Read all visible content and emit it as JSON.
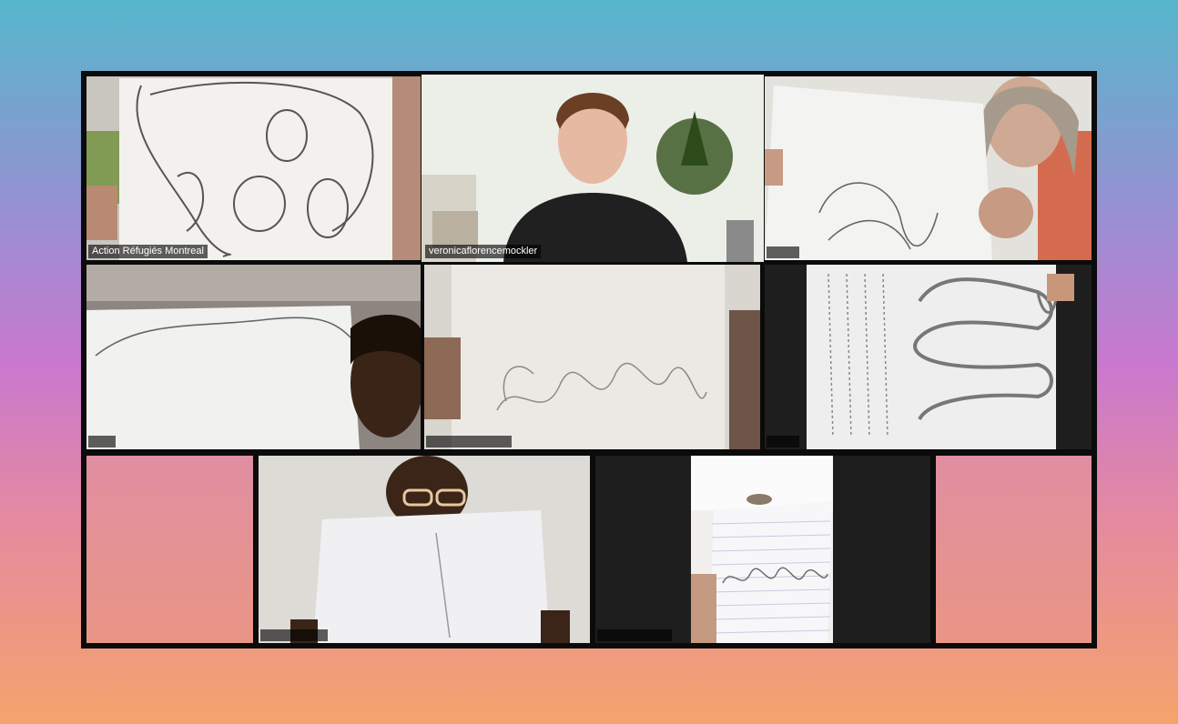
{
  "meeting": {
    "participants": [
      {
        "id": "p1",
        "name": "Action Réfugiés Montreal",
        "visible_name": true
      },
      {
        "id": "p2",
        "name": "veronicaflorencemockler",
        "visible_name": true,
        "active_speaker": true
      },
      {
        "id": "p3",
        "name": "",
        "visible_name": false
      },
      {
        "id": "p4",
        "name": "",
        "visible_name": false
      },
      {
        "id": "p5",
        "name": "",
        "visible_name": false
      },
      {
        "id": "p6",
        "name": "",
        "visible_name": false
      },
      {
        "id": "p7",
        "name": "",
        "visible_name": false
      },
      {
        "id": "p8",
        "name": "",
        "visible_name": false
      }
    ],
    "colors": {
      "active_speaker_border": "#a9d67a",
      "frame": "#0b0b0b",
      "label_bg": "rgba(0,0,0,0.62)"
    }
  }
}
